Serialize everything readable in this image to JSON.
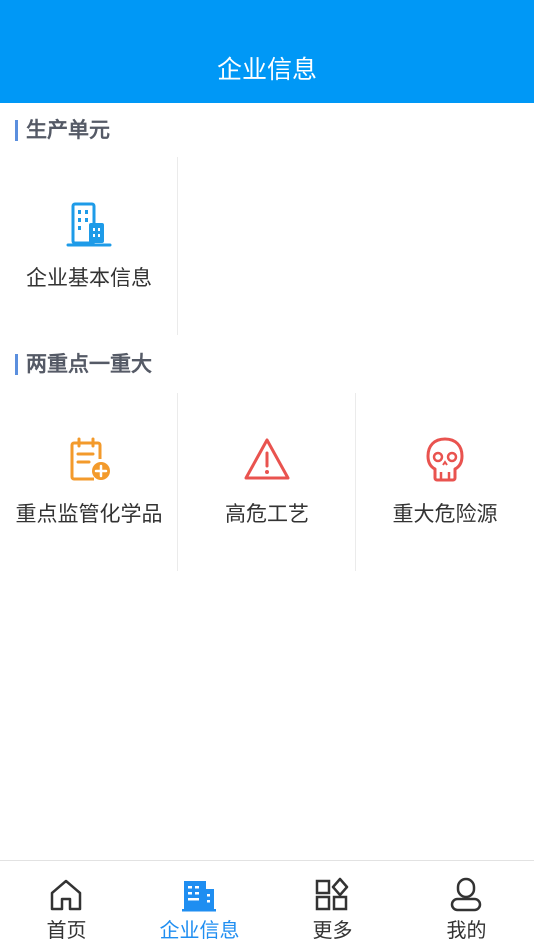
{
  "header": {
    "title": "企业信息"
  },
  "sections": [
    {
      "title": "生产单元",
      "items": [
        {
          "label": "企业基本信息",
          "icon": "building-icon"
        }
      ]
    },
    {
      "title": "两重点一重大",
      "items": [
        {
          "label": "重点监管化学品",
          "icon": "clipboard-add-icon"
        },
        {
          "label": "高危工艺",
          "icon": "warning-triangle-icon"
        },
        {
          "label": "重大危险源",
          "icon": "skull-icon"
        }
      ]
    }
  ],
  "tabbar": [
    {
      "label": "首页",
      "icon": "home-icon",
      "active": false
    },
    {
      "label": "企业信息",
      "icon": "enterprise-icon",
      "active": true
    },
    {
      "label": "更多",
      "icon": "grid-more-icon",
      "active": false
    },
    {
      "label": "我的",
      "icon": "user-icon",
      "active": false
    }
  ],
  "colors": {
    "header": "#0098f6",
    "accent": "#1f8ef1",
    "building": "#1e9be8",
    "orange": "#f39a2b",
    "red": "#e9534f"
  }
}
